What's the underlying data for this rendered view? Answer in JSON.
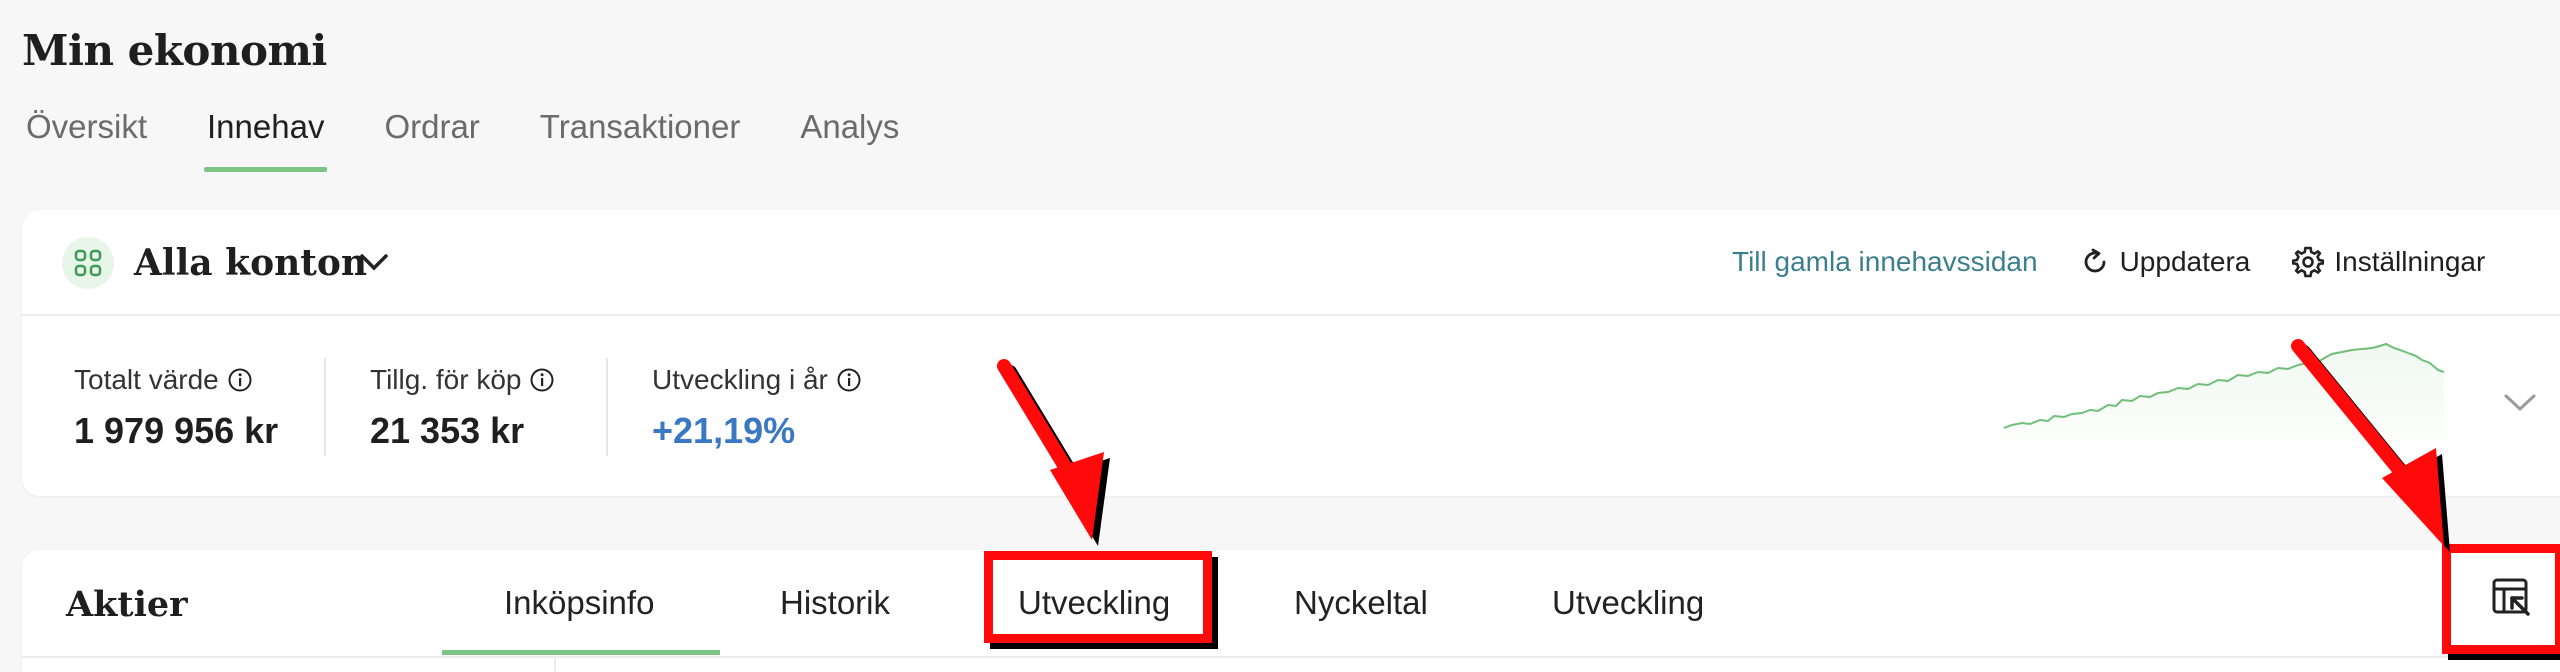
{
  "page": {
    "title": "Min ekonomi"
  },
  "main_tabs": [
    {
      "label": "Översikt"
    },
    {
      "label": "Innehav",
      "active": true
    },
    {
      "label": "Ordrar"
    },
    {
      "label": "Transaktioner"
    },
    {
      "label": "Analys"
    }
  ],
  "account": {
    "selector_label": "Alla konton",
    "old_page_link": "Till gamla innehavssidan",
    "refresh_label": "Uppdatera",
    "settings_label": "Inställningar"
  },
  "stats": [
    {
      "label": "Totalt värde",
      "value": "1 979 956 kr"
    },
    {
      "label": "Tillg. för köp",
      "value": "21 353 kr"
    },
    {
      "label": "Utveckling i år",
      "value": "+21,19%"
    }
  ],
  "holdings": {
    "title": "Aktier",
    "tabs": [
      {
        "label": "Inköpsinfo",
        "active": true
      },
      {
        "label": "Historik"
      },
      {
        "label": "Utveckling"
      },
      {
        "label": "Nyckeltal"
      },
      {
        "label": "Utveckling"
      }
    ]
  },
  "colors": {
    "accent_green": "#7dc383",
    "link_teal": "#3c7f8c",
    "positive_blue": "#3a78c4",
    "annotation_red": "#ff0a0a"
  }
}
